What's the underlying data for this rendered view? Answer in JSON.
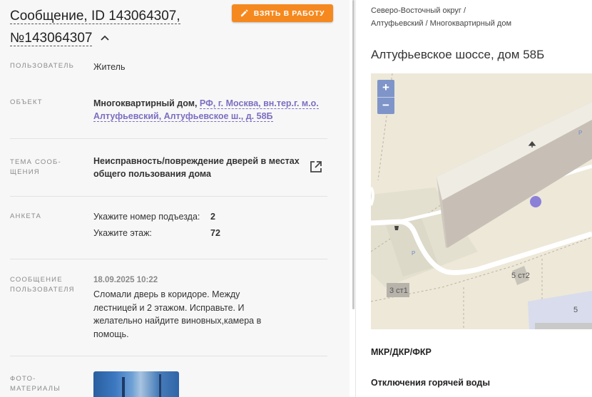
{
  "header": {
    "title_line1": "Сообщение, ID 143064307,",
    "title_line2": "№143064307",
    "take_button": "ВЗЯТЬ В РАБОТУ"
  },
  "fields": {
    "user_label": "ПОЛЬЗОВАТЕЛЬ",
    "user_value": "Житель",
    "object_label": "ОБЪЕКТ",
    "object_type": "Многоквартирный дом,",
    "object_address_1": "РФ, г. Москва, вн.тер.г. м.о.",
    "object_address_2": "Алтуфьевский, Алтуфьевское ш., д. 58Б",
    "topic_label_1": "ТЕМА СООБ-",
    "topic_label_2": "ЩЕНИЯ",
    "topic_value_1": "Неисправность/повреждение дверей в местах",
    "topic_value_2": "общего пользования дома",
    "survey_label": "АНКЕТА",
    "survey": [
      {
        "q": "Укажите номер подъезда:",
        "a": "2"
      },
      {
        "q": "Укажите этаж:",
        "a": "72"
      }
    ],
    "message_label_1": "СООБЩЕНИЕ",
    "message_label_2": "ПОЛЬЗОВАТЕЛЯ",
    "message_date": "18.09.2025 10:22",
    "message_lines": [
      "Сломали дверь в коридоре. Между",
      "лестницей и 2 этажом. Исправьте. И",
      "желательно найдите виновных,камера в",
      "помощь."
    ],
    "photo_label_1": "ФОТО-",
    "photo_label_2": "МАТЕРИАЛЫ"
  },
  "right": {
    "breadcrumb_1": "Северо-Восточный округ /",
    "breadcrumb_2": "Алтуфьевский / Многоквартирный дом",
    "address_title": "Алтуфьевское шоссе, дом 58Б",
    "map": {
      "zoom_in": "+",
      "zoom_out": "−",
      "labels": [
        "5 ст2",
        "3 ст1",
        "5",
        "P",
        "P"
      ]
    },
    "section_mkr": "МКР/ДКР/ФКР",
    "section_hot_water": "Отключения горячей воды"
  },
  "colors": {
    "accent_orange": "#f5891f",
    "link_purple": "#7b6fc2",
    "marker": "#8a80d8"
  }
}
